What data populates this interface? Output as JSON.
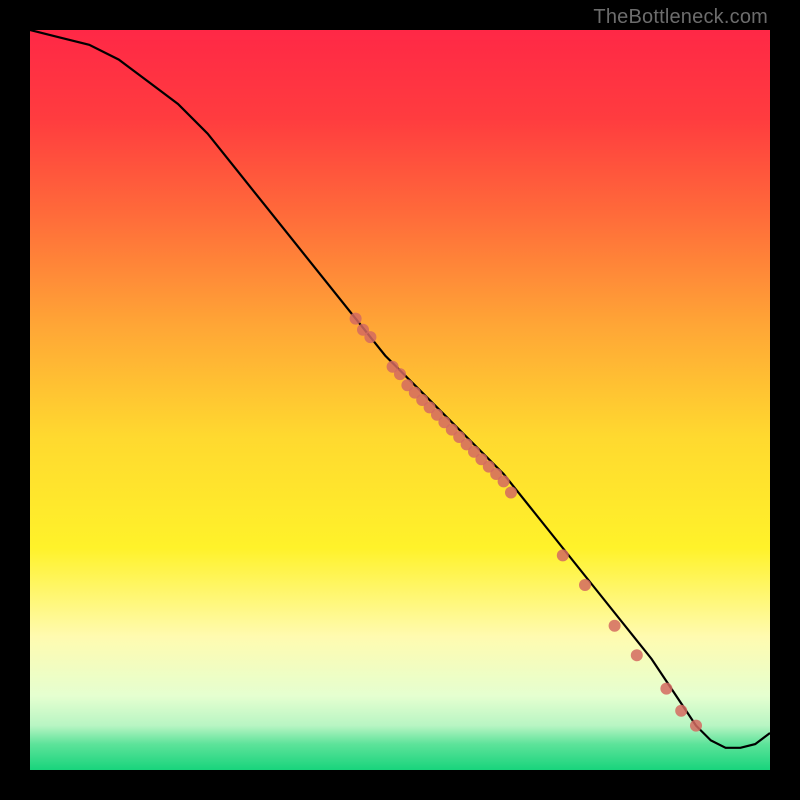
{
  "watermark": "TheBottleneck.com",
  "chart_data": {
    "type": "line",
    "title": "",
    "xlabel": "",
    "ylabel": "",
    "xlim": [
      0,
      100
    ],
    "ylim": [
      0,
      100
    ],
    "grid": false,
    "background_gradient": {
      "stops": [
        {
          "pos": 0.0,
          "color": "#ff2846"
        },
        {
          "pos": 0.12,
          "color": "#ff3c3f"
        },
        {
          "pos": 0.25,
          "color": "#ff6b3a"
        },
        {
          "pos": 0.4,
          "color": "#ffa636"
        },
        {
          "pos": 0.55,
          "color": "#ffd92f"
        },
        {
          "pos": 0.7,
          "color": "#fff22a"
        },
        {
          "pos": 0.82,
          "color": "#fffbb0"
        },
        {
          "pos": 0.9,
          "color": "#e5ffd0"
        },
        {
          "pos": 0.94,
          "color": "#b8f5c3"
        },
        {
          "pos": 0.965,
          "color": "#5de39a"
        },
        {
          "pos": 1.0,
          "color": "#18d47c"
        }
      ]
    },
    "series": [
      {
        "name": "bottleneck-curve",
        "color": "#000000",
        "x": [
          0,
          4,
          8,
          12,
          16,
          20,
          24,
          28,
          32,
          36,
          40,
          44,
          48,
          52,
          56,
          60,
          64,
          68,
          72,
          76,
          80,
          84,
          88,
          90,
          92,
          94,
          96,
          98,
          100
        ],
        "y": [
          100,
          99,
          98,
          96,
          93,
          90,
          86,
          81,
          76,
          71,
          66,
          61,
          56,
          52,
          48,
          44,
          40,
          35,
          30,
          25,
          20,
          15,
          9,
          6,
          4,
          3,
          3,
          3.5,
          5
        ]
      }
    ],
    "markers": {
      "name": "data-points",
      "color": "#d46a60",
      "x": [
        44,
        45,
        46,
        49,
        50,
        51,
        52,
        53,
        54,
        55,
        56,
        57,
        58,
        59,
        60,
        61,
        62,
        63,
        64,
        65,
        72,
        75,
        79,
        82,
        86,
        88,
        90
      ],
      "y": [
        61,
        59.5,
        58.5,
        54.5,
        53.5,
        52,
        51,
        50,
        49,
        48,
        47,
        46,
        45,
        44,
        43,
        42,
        41,
        40,
        39,
        37.5,
        29,
        25,
        19.5,
        15.5,
        11,
        8,
        6
      ],
      "radius": 6
    }
  }
}
